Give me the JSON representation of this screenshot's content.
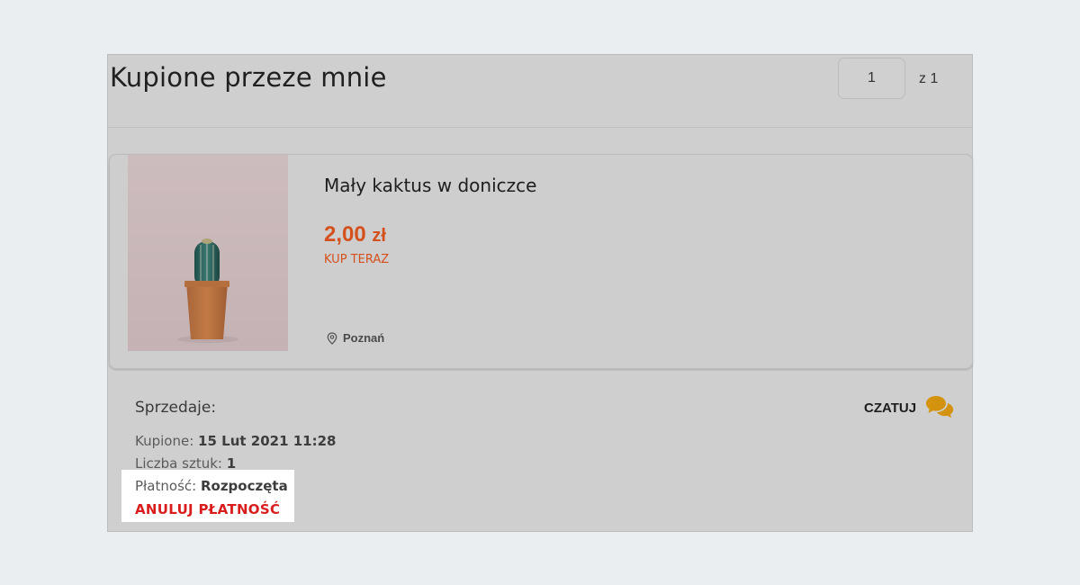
{
  "page": {
    "title": "Kupione przeze mnie",
    "pagination": {
      "current": "1",
      "of_text": "z 1"
    }
  },
  "item": {
    "name": "Mały kaktus w doniczce",
    "price_main": "2,00",
    "price_currency": "zł",
    "buy_type": "KUP TERAZ",
    "location": "Poznań",
    "image_icon": "cactus-in-pot-photo"
  },
  "order": {
    "seller_label": "Sprzedaje:",
    "purchased_label": "Kupione:",
    "purchased_value": "15 Lut 2021 11:28",
    "quantity_label": "Liczba sztuk:",
    "quantity_value": "1",
    "payment_label": "Płatność:",
    "payment_value": "Rozpoczęta",
    "cancel_label": "ANULUJ PŁATNOŚĆ"
  },
  "chat": {
    "label": "CZATUJ",
    "icon": "chat-bubbles-icon"
  },
  "colors": {
    "price": "#d4501c",
    "cancel": "#d91d1d",
    "chat_icon": "#d4930f"
  }
}
